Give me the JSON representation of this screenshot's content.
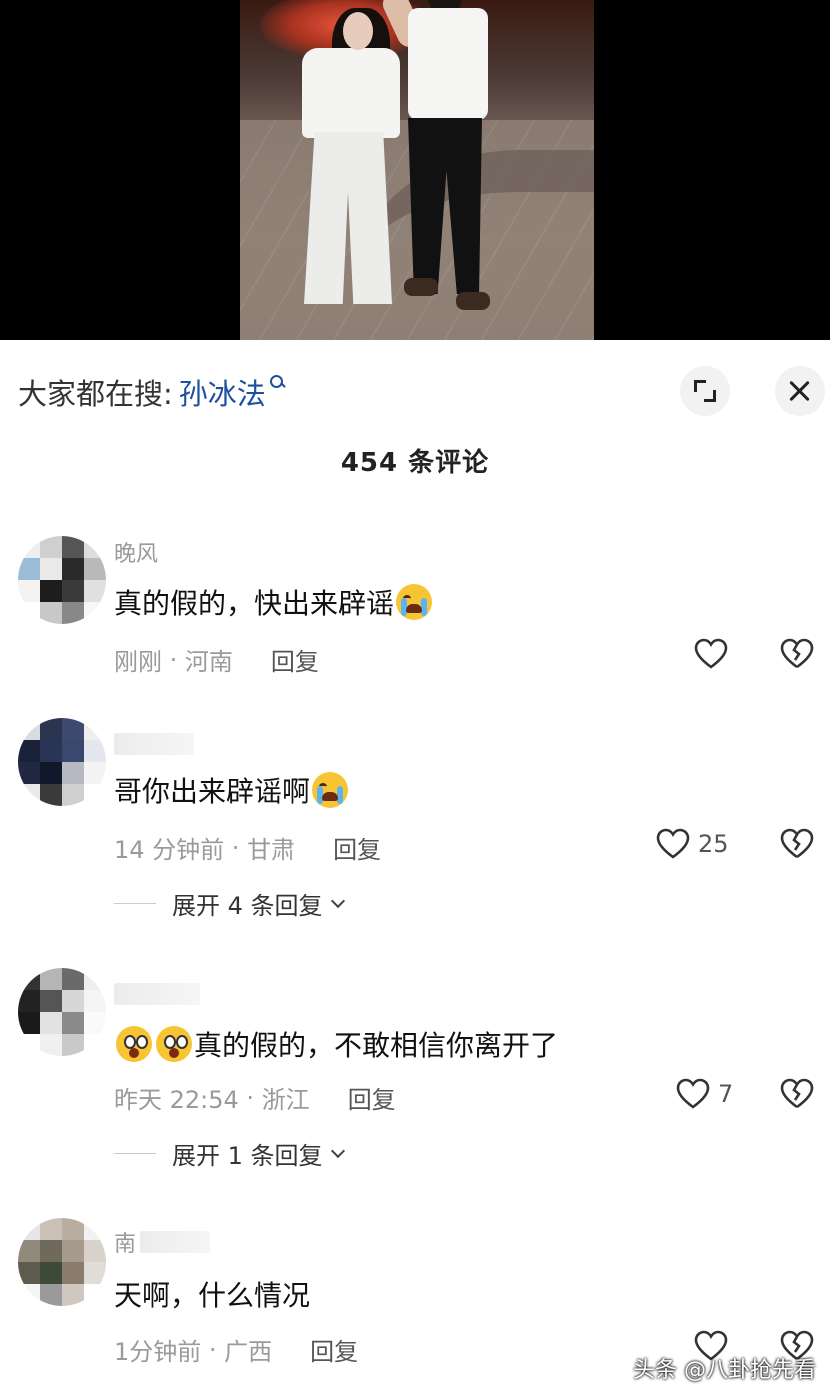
{
  "search": {
    "prefix": "大家都在搜:",
    "term": "孙冰法"
  },
  "comments_title": "454 条评论",
  "comments": [
    {
      "username": "晚风",
      "text": "真的假的，快出来辟谣",
      "emoji": "crying-face",
      "time": "刚刚",
      "location": "河南",
      "reply_label": "回复",
      "likes": ""
    },
    {
      "username": "",
      "text": "哥你出来辟谣啊",
      "emoji": "loudly-crying-face",
      "time": "14 分钟前",
      "location": "甘肃",
      "reply_label": "回复",
      "likes": "25",
      "expand_label": "展开 4 条回复"
    },
    {
      "username": "",
      "text": "真的假的，不敢相信你离开了",
      "emoji": "shocked-face",
      "time": "昨天 22:54",
      "location": "浙江",
      "reply_label": "回复",
      "likes": "7",
      "expand_label": "展开 1 条回复"
    },
    {
      "username": "南",
      "text": "天啊，什么情况",
      "time": "1分钟前",
      "location": "广西",
      "reply_label": "回复",
      "likes": ""
    }
  ],
  "watermark": "头条 @八卦抢先看",
  "colors": {
    "search_term": "#1f4fa0",
    "meta_text": "#9a9a9a",
    "background": "#ffffff"
  }
}
